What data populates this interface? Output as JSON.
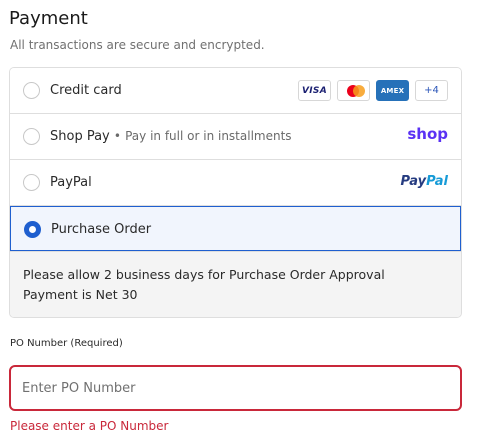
{
  "header": {
    "title": "Payment",
    "subtitle": "All transactions are secure and encrypted."
  },
  "methods": {
    "credit_card": {
      "label": "Credit card",
      "badges": {
        "visa": "VISA",
        "amex": "AMEX",
        "more": "+4"
      }
    },
    "shop_pay": {
      "label": "Shop Pay",
      "separator": "•",
      "description": "Pay in full or in installments",
      "logo": "shop"
    },
    "paypal": {
      "label": "PayPal",
      "logo_pay": "Pay",
      "logo_pal": "Pal"
    },
    "purchase_order": {
      "label": "Purchase Order",
      "selected": true,
      "info_line1": "Please allow 2 business days for Purchase Order Approval",
      "info_line2": "Payment is Net 30"
    }
  },
  "po_field": {
    "label": "PO Number (Required)",
    "placeholder": "Enter PO Number",
    "value": "",
    "error": "Please enter a PO Number"
  },
  "colors": {
    "selected_accent": "#1f5fcf",
    "error": "#c9283a",
    "shop_purple": "#5a31f4"
  }
}
